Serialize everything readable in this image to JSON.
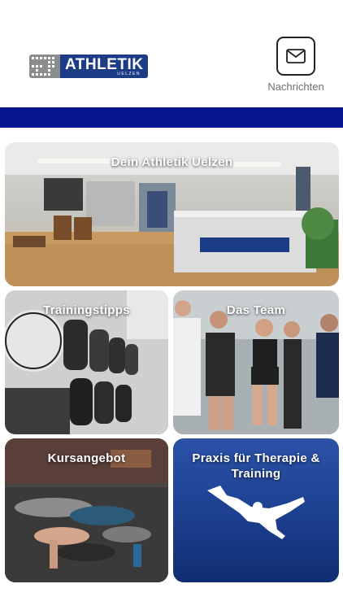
{
  "header": {
    "logo": {
      "name": "ATHLETIK",
      "sub": "UELZEN"
    },
    "messages": {
      "label": "Nachrichten",
      "icon": "envelope-icon"
    }
  },
  "colors": {
    "band": "#07168e",
    "brand_blue": "#1c3d86",
    "praxis_blue": "#1c3f8e",
    "logo_gray": "#8a8c8e"
  },
  "tiles": [
    {
      "title": "Dein Athletik Uelzen"
    },
    {
      "title": "Trainingstipps"
    },
    {
      "title": "Das Team"
    },
    {
      "title": "Kursangebot"
    },
    {
      "title": "Praxis für Therapie & Training"
    }
  ]
}
